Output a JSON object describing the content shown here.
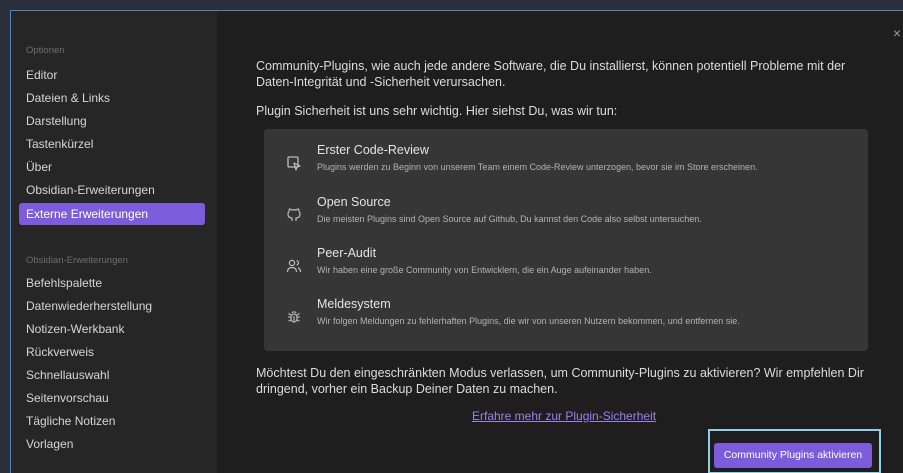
{
  "sidebar": {
    "options_title": "Optionen",
    "options_items": [
      {
        "label": "Editor"
      },
      {
        "label": "Dateien & Links"
      },
      {
        "label": "Darstellung"
      },
      {
        "label": "Tastenkürzel"
      },
      {
        "label": "Über"
      },
      {
        "label": "Obsidian-Erweiterungen"
      },
      {
        "label": "Externe Erweiterungen",
        "active": true
      }
    ],
    "ext_title": "Obsidian-Erweiterungen",
    "ext_items": [
      {
        "label": "Befehlspalette"
      },
      {
        "label": "Datenwiederherstellung"
      },
      {
        "label": "Notizen-Werkbank"
      },
      {
        "label": "Rückverweis"
      },
      {
        "label": "Schnellauswahl"
      },
      {
        "label": "Seitenvorschau"
      },
      {
        "label": "Tägliche Notizen"
      },
      {
        "label": "Vorlagen"
      }
    ]
  },
  "close_icon": "×",
  "content": {
    "intro_line1": "Community-Plugins, wie auch jede andere Software, die Du installierst, können potentiell Probleme mit der",
    "intro_line2": "Daten-Integrität und -Sicherheit verursachen.",
    "security_intro": "Plugin Sicherheit ist uns sehr wichtig. Hier siehst Du, was wir tun:",
    "features": [
      {
        "title": "Erster Code-Review",
        "desc": "Plugins werden zu Beginn von unserem Team einem Code-Review unterzogen, bevor sie im Store erscheinen.",
        "icon": "review-icon"
      },
      {
        "title": "Open Source",
        "desc": "Die meisten Plugins sind Open Source auf Github, Du kannst den Code also selbst untersuchen.",
        "icon": "github-icon"
      },
      {
        "title": "Peer-Audit",
        "desc": "Wir haben eine große Community von Entwicklern, die ein Auge aufeinander haben.",
        "icon": "users-icon"
      },
      {
        "title": "Meldesystem",
        "desc": "Wir folgen Meldungen zu fehlerhaften Plugins, die wir von unseren Nutzern bekommen, und entfernen sie.",
        "icon": "bug-icon"
      }
    ],
    "question_line1": "Möchtest Du den eingeschränkten Modus verlassen, um Community-Plugins zu aktivieren? Wir empfehlen Dir",
    "question_line2": "dringend, vorher ein Backup Deiner Daten zu machen.",
    "learn_more_link": "Erfahre mehr zur Plugin-Sicherheit",
    "activate_button": "Community Plugins aktivieren"
  },
  "colors": {
    "accent": "#7c5cdb",
    "link": "#9b82ee",
    "highlight_border": "#8fd0e8"
  }
}
